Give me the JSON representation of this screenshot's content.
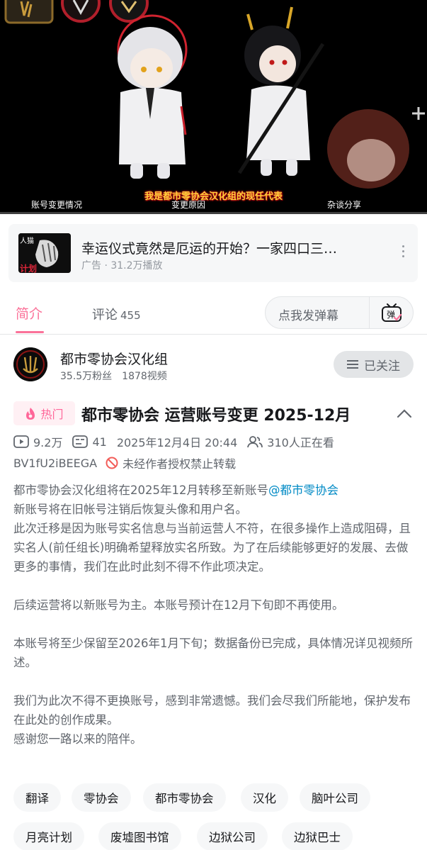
{
  "player": {
    "subtitle": "我是都市零协会汉化组的现任代表",
    "chapters": [
      "账号变更情况",
      "变更原因",
      "杂谈分享"
    ]
  },
  "ad": {
    "thumb_text": "计划",
    "title": "幸运仪式竟然是厄运的开始？一家四口三…",
    "meta": "广告 · 31.2万播放",
    "more_icon": "more-vertical-icon"
  },
  "tabs": {
    "intro": "简介",
    "comments_label": "评论",
    "comments_count": "455",
    "danmaku_placeholder": "点我发弹幕",
    "danmaku_icon_char": "弹"
  },
  "uploader": {
    "name": "都市零协会汉化组",
    "fans": "35.5万粉丝",
    "videos": "1878视频",
    "follow_label": "已关注"
  },
  "video": {
    "hot_label": "热门",
    "title": "都市零协会 运营账号变更 2025-12月",
    "views": "9.2万",
    "danmaku_count": "41",
    "date": "2025年12月4日 20:44",
    "watching": "310人正在看",
    "bvid": "BV1fU2iBEEGA",
    "repost_notice": "未经作者授权禁止转载"
  },
  "description": {
    "line1_prefix": "都市零协会汉化组将在2025年12月转移至新账号",
    "mention": "@都市零协会",
    "line2": "新账号将在旧帐号注销后恢复头像和用户名。",
    "para1": "此次迁移是因为账号实名信息与当前运营人不符，在很多操作上造成阻碍，且实名人(前任组长)明确希望释放实名所致。为了在后续能够更好的发展、去做更多的事情，我们在此时此刻不得不作此项决定。",
    "para2": "后续运营将以新账号为主。本账号预计在12月下旬即不再使用。",
    "para3": "本账号将至少保留至2026年1月下旬；数据备份已完成，具体情况详见视频所述。",
    "para4": "我们为此次不得不更换账号，感到非常遗憾。我们会尽我们所能地，保护发布在此处的创作成果。",
    "para5": "感谢您一路以来的陪伴。"
  },
  "tags": [
    "翻译",
    "零协会",
    "都市零协会",
    "汉化",
    "脑叶公司",
    "月亮计划",
    "废墟图书馆",
    "边狱公司",
    "边狱巴士"
  ],
  "colors": {
    "accent": "#fb7299",
    "hot_text": "#ff6699",
    "mention": "#008ac5",
    "secondary_text": "#61666d"
  }
}
